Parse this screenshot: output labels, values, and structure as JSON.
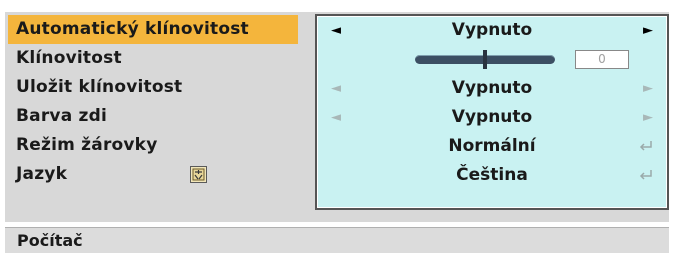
{
  "menu": {
    "items": [
      {
        "label": "Automatický klínovitost",
        "selected": true
      },
      {
        "label": "Klínovitost",
        "selected": false
      },
      {
        "label": "Uložit klínovitost",
        "selected": false
      },
      {
        "label": "Barva zdi",
        "selected": false
      },
      {
        "label": "Režim žárovky",
        "selected": false
      },
      {
        "label": "Jazyk",
        "selected": false
      }
    ],
    "language_icon": "language-flag-icon"
  },
  "values": {
    "auto_keystone": "Vypnuto",
    "keystone_value": "0",
    "keystone_level": 0.5,
    "save_keystone": "Vypnuto",
    "wall_color": "Vypnuto",
    "lamp_mode": "Normální",
    "language": "Čeština"
  },
  "icons": {
    "left_arrow": "◄",
    "right_arrow": "►",
    "enter": "enter-icon"
  },
  "status": {
    "source": "Počítač"
  },
  "colors": {
    "highlight": "#f4b53c",
    "values_bg": "#c9f2f2",
    "panel_bg": "#d8d8d8"
  }
}
